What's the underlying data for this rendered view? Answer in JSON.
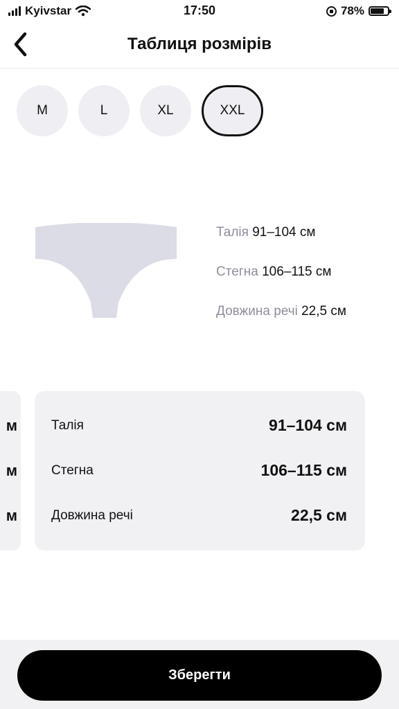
{
  "status_bar": {
    "carrier": "Kyivstar",
    "time": "17:50",
    "battery": "78%",
    "battery_level": 0.78
  },
  "nav": {
    "back_icon": "chevron-left-icon",
    "title": "Таблиця розмірів"
  },
  "sizes": [
    {
      "label": "M",
      "selected": false
    },
    {
      "label": "L",
      "selected": false
    },
    {
      "label": "XL",
      "selected": false
    },
    {
      "label": "XXL",
      "selected": true
    }
  ],
  "illustration": {
    "icon": "briefs-icon",
    "color": "#dcdce6"
  },
  "measures": [
    {
      "label": "Талія",
      "value": "91–104 см"
    },
    {
      "label": "Стегна",
      "value": "106–115 см"
    },
    {
      "label": "Довжина речі",
      "value": "22,5 см"
    }
  ],
  "card": {
    "rows": [
      {
        "label": "Талія",
        "value": "91–104 см"
      },
      {
        "label": "Стегна",
        "value": "106–115 см"
      },
      {
        "label": "Довжина речі",
        "value": "22,5 см"
      }
    ]
  },
  "card_peek": {
    "glyphs": [
      "м",
      "м",
      "м"
    ]
  },
  "footer": {
    "save_label": "Зберегти"
  }
}
